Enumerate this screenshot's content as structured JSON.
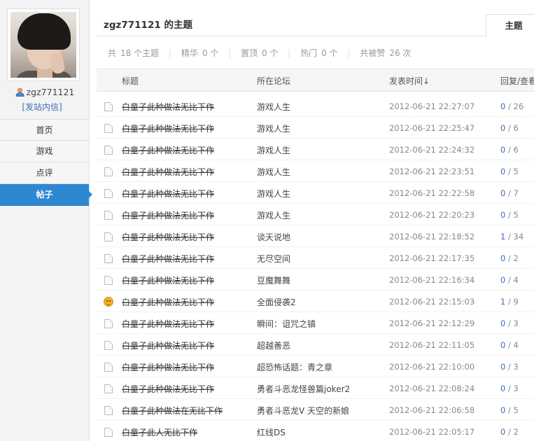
{
  "sidebar": {
    "username": "zgz771121",
    "send_message": "[发站内信]",
    "nav": [
      {
        "label": "首页",
        "active": false
      },
      {
        "label": "游戏",
        "active": false
      },
      {
        "label": "点评",
        "active": false
      },
      {
        "label": "帖子",
        "active": true
      }
    ]
  },
  "header": {
    "title": "zgz771121 的主题",
    "tab_label": "主题"
  },
  "stats": {
    "total_label": "共",
    "total_value": "18 个主题",
    "digest_label": "精华",
    "digest_value": "0 个",
    "sticky_label": "置顶",
    "sticky_value": "0 个",
    "hot_label": "热门",
    "hot_value": "0 个",
    "likes_label": "共被赞",
    "likes_value": "26 次"
  },
  "table": {
    "columns": {
      "title": "标题",
      "forum": "所在论坛",
      "time": "发表时间↓",
      "replies": "回复/查看"
    },
    "rows": [
      {
        "icon": "document-icon",
        "title": "白童子此种做法无比下作",
        "forum": "游戏人生",
        "time": "2012-06-21 22:27:07",
        "replies": "0",
        "views": "/ 26"
      },
      {
        "icon": "document-icon",
        "title": "白童子此种做法无比下作",
        "forum": "游戏人生",
        "time": "2012-06-21 22:25:47",
        "replies": "0",
        "views": "/ 6"
      },
      {
        "icon": "document-icon",
        "title": "白童子此种做法无比下作",
        "forum": "游戏人生",
        "time": "2012-06-21 22:24:32",
        "replies": "0",
        "views": "/ 6"
      },
      {
        "icon": "document-icon",
        "title": "白童子此种做法无比下作",
        "forum": "游戏人生",
        "time": "2012-06-21 22:23:51",
        "replies": "0",
        "views": "/ 5"
      },
      {
        "icon": "document-icon",
        "title": "白童子此种做法无比下作",
        "forum": "游戏人生",
        "time": "2012-06-21 22:22:58",
        "replies": "0",
        "views": "/ 7"
      },
      {
        "icon": "document-icon",
        "title": "白童子此种做法无比下作",
        "forum": "游戏人生",
        "time": "2012-06-21 22:20:23",
        "replies": "0",
        "views": "/ 5"
      },
      {
        "icon": "document-icon",
        "title": "白童子此种做法无比下作",
        "forum": "谈天说地",
        "time": "2012-06-21 22:18:52",
        "replies": "1",
        "views": "/ 34"
      },
      {
        "icon": "document-icon",
        "title": "白童子此种做法无比下作",
        "forum": "无尽空间",
        "time": "2012-06-21 22:17:35",
        "replies": "0",
        "views": "/ 2"
      },
      {
        "icon": "document-icon",
        "title": "白童子此种做法无比下作",
        "forum": "豆魔舞舞",
        "time": "2012-06-21 22:16:34",
        "replies": "0",
        "views": "/ 4"
      },
      {
        "icon": "smiley-icon",
        "title": "白童子此种做法无比下作",
        "forum": "全面侵袭2",
        "time": "2012-06-21 22:15:03",
        "replies": "1",
        "views": "/ 9"
      },
      {
        "icon": "document-icon",
        "title": "白童子此种做法无比下作",
        "forum": "瞬间：诅咒之镇",
        "time": "2012-06-21 22:12:29",
        "replies": "0",
        "views": "/ 3"
      },
      {
        "icon": "document-icon",
        "title": "白童子此种做法无比下作",
        "forum": "超越善恶",
        "time": "2012-06-21 22:11:05",
        "replies": "0",
        "views": "/ 4"
      },
      {
        "icon": "document-icon",
        "title": "白童子此种做法无比下作",
        "forum": "超恐怖话题：青之章",
        "time": "2012-06-21 22:10:00",
        "replies": "0",
        "views": "/ 3"
      },
      {
        "icon": "document-icon",
        "title": "白童子此种做法无比下作",
        "forum": "勇者斗恶龙怪兽篇joker2",
        "time": "2012-06-21 22:08:24",
        "replies": "0",
        "views": "/ 3"
      },
      {
        "icon": "document-icon",
        "title": "白童子此种做法在无比下作",
        "forum": "勇者斗恶龙Ⅴ 天空的新娘",
        "time": "2012-06-21 22:06:58",
        "replies": "0",
        "views": "/ 5"
      },
      {
        "icon": "document-icon",
        "title": "白童子此人无比下作",
        "forum": "红线DS",
        "time": "2012-06-21 22:05:17",
        "replies": "0",
        "views": "/ 2"
      }
    ]
  }
}
